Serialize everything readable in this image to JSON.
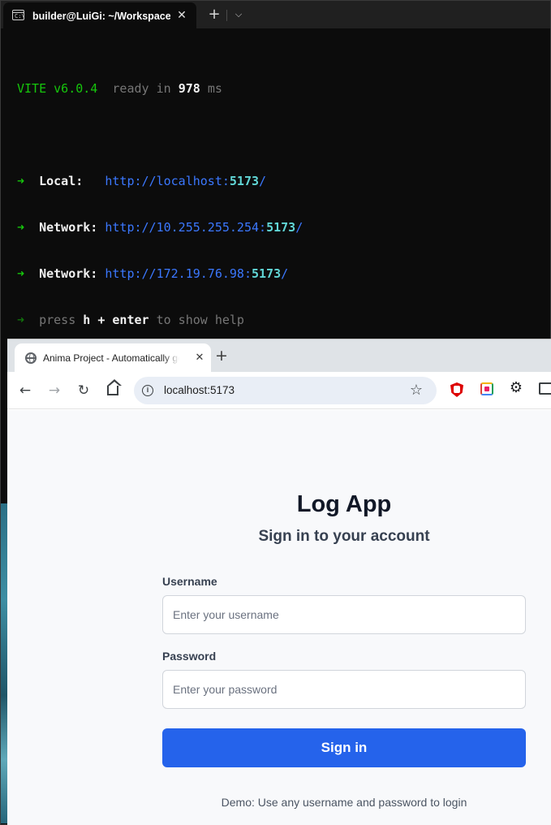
{
  "terminal": {
    "tab_title": "builder@LuiGi: ~/Workspaces",
    "tab_icon_text": "C:\\",
    "close_glyph": "✕",
    "newtab_glyph": "+",
    "dropdown_glyph": "⌵",
    "vite": {
      "name": "VITE",
      "version": "v6.0.4",
      "ready_text": "ready in",
      "ready_ms": "978",
      "ms_unit": "ms"
    },
    "arrow": "➜",
    "local_label": "Local:",
    "local_url_prefix": "http://localhost:",
    "local_port": "5173",
    "network1_label": "Network:",
    "network1_url_prefix": "http://10.255.255.254:",
    "network1_port": "5173",
    "network2_label": "Network:",
    "network2_url_prefix": "http://172.19.76.98:",
    "network2_port": "5173",
    "url_suffix": "/",
    "help_press": "press",
    "help_key": "h + enter",
    "help_rest": "to show help"
  },
  "browser": {
    "tab_title": "Anima Project - Automatically generated",
    "tab_close": "✕",
    "newtab": "+",
    "back": "←",
    "forward": "→",
    "reload": "↻",
    "info": "i",
    "url": "localhost:5173",
    "star": "☆",
    "gear": "⚙"
  },
  "login": {
    "title": "Log App",
    "subtitle": "Sign in to your account",
    "username_label": "Username",
    "username_placeholder": "Enter your username",
    "username_value": "",
    "password_label": "Password",
    "password_placeholder": "Enter your password",
    "password_value": "",
    "submit_label": "Sign in",
    "demo_note": "Demo: Use any username and password to login"
  },
  "colors": {
    "primary_button": "#2563eb",
    "terminal_green": "#16c60c",
    "terminal_blue": "#3b78ff",
    "terminal_cyan": "#61d6d6"
  }
}
